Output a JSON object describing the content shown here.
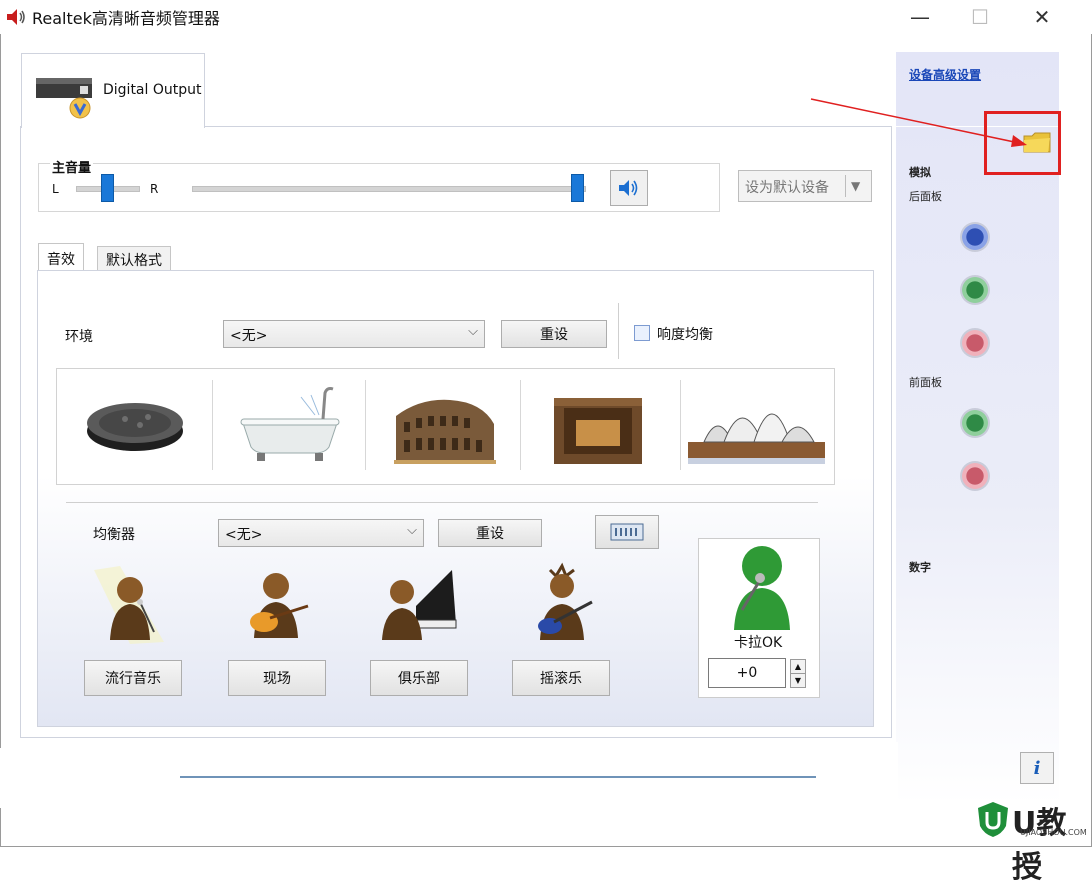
{
  "window": {
    "title": "Realtek高清晰音频管理器",
    "controls": {
      "minimize": "—",
      "maximize": "☐",
      "close": "✕"
    }
  },
  "device_tab": {
    "label": "Digital Output"
  },
  "volume": {
    "title": "主音量",
    "left_label": "L",
    "right_label": "R",
    "balance_level": 0.5,
    "master_level": 1.0,
    "set_default_label": "设为默认设备",
    "dropdown_arrow": "▼"
  },
  "sub_tabs": [
    {
      "label": "音效",
      "active": true
    },
    {
      "label": "默认格式",
      "active": false
    }
  ],
  "environment": {
    "label": "环境",
    "value": "<无>",
    "reset_label": "重设",
    "loudness_label": "响度均衡",
    "loudness_checked": false,
    "presets": [
      "stone-disc",
      "bathtub",
      "colosseum",
      "stone-room",
      "opera-house"
    ]
  },
  "equalizer": {
    "label": "均衡器",
    "value": "<无>",
    "reset_label": "重设",
    "buttons": [
      "流行音乐",
      "现场",
      "俱乐部",
      "摇滚乐"
    ]
  },
  "karaoke": {
    "label": "卡拉OK",
    "value": "+0"
  },
  "right_panel": {
    "advanced_link": "设备高级设置",
    "analog_label": "模拟",
    "rear_panel_label": "后面板",
    "front_panel_label": "前面板",
    "digital_label": "数字",
    "jack_colors": {
      "blue": "#3a62c9",
      "green": "#3d9a55",
      "pink": "#d9707f"
    }
  },
  "info_button": {
    "label": "i"
  },
  "watermark": {
    "text": "U教授",
    "sub": "UJIAOSHOU.COM"
  },
  "colors": {
    "accent_blue": "#1a78d8",
    "annotation_red": "#e02020"
  }
}
